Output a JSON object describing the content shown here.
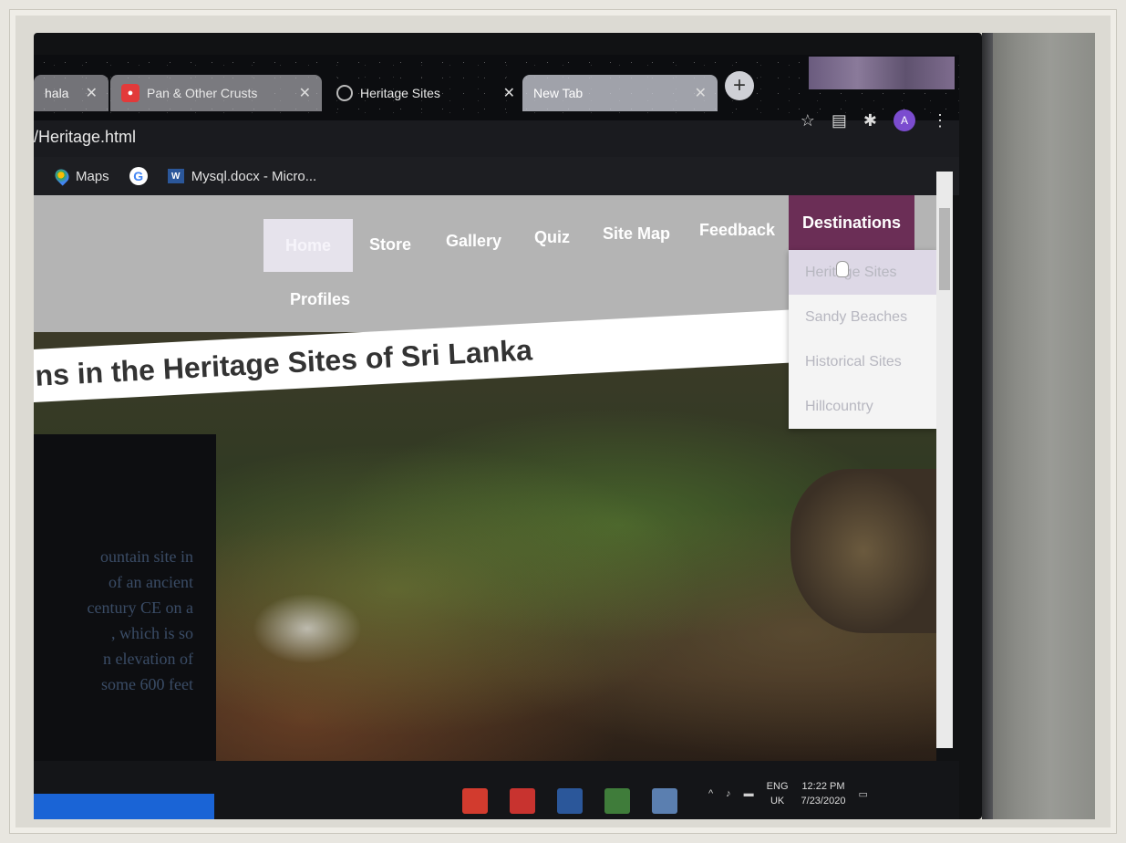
{
  "browser": {
    "tabs": [
      {
        "title": "hala",
        "icon": "blank-icon"
      },
      {
        "title": "Pan & Other Crusts",
        "icon": "pizza-hut-icon"
      },
      {
        "title": "Heritage Sites",
        "icon": "globe-icon"
      },
      {
        "title": "New Tab",
        "icon": "blank-icon"
      }
    ],
    "new_tab": "+",
    "url": "/Heritage.html",
    "profile_initial": "A",
    "bookmarks": [
      {
        "label": "Maps"
      },
      {
        "label": ""
      },
      {
        "label": "Mysql.docx - Micro..."
      }
    ]
  },
  "site": {
    "nav": {
      "home": "Home",
      "store": "Store",
      "gallery": "Gallery",
      "quiz": "Quiz",
      "sitemap": "Site Map",
      "feedback": "Feedback",
      "destinations": "Destinations",
      "profiles": "Profiles"
    },
    "dropdown": [
      "Heritage Sites",
      "Sandy Beaches",
      "Historical Sites",
      "Hillcountry"
    ],
    "title": "ns in the Heritage Sites of Sri Lanka",
    "info_lines": [
      "ountain site in",
      "of an ancient",
      "century CE on a",
      ", which is so",
      "n elevation of",
      "some 600 feet"
    ]
  },
  "taskbar": {
    "lang": "ENG",
    "region": "UK",
    "time": "12:22 PM",
    "date": "7/23/2020"
  },
  "colors": {
    "nav_bg": "#b4b4b4",
    "destinations_bg": "#6b2e56",
    "dropdown_active": "#ddd8e6"
  }
}
